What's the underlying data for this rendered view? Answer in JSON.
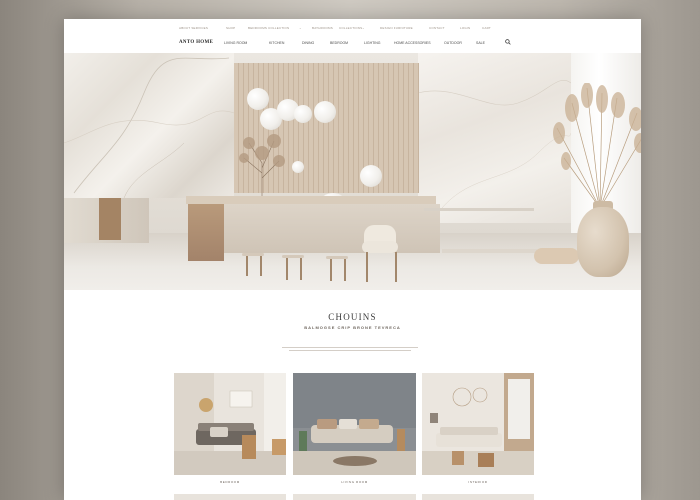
{
  "topnav": {
    "items": [
      "ABOUT SERVICES",
      "SHOP",
      "BEDROOMS COLLECTION",
      "BATHROOMS",
      "COLLECTIONS",
      "DESIGN FURNITURE",
      "CONTACT",
      "LOGIN",
      "CART"
    ]
  },
  "mainnav": {
    "logo": "ANTO HOME",
    "links": [
      "LIVING ROOM",
      "KITCHEN",
      "DINING",
      "BEDROOM",
      "LIGHTING",
      "HOME ACCESSORIES",
      "OUTDOOR",
      "SALE"
    ]
  },
  "hero": {
    "slide_count": 4,
    "active_slide": 1
  },
  "section": {
    "title": "CHOUINS",
    "subtitle": "BALMOGSE CRIP BRONE TEVRECA"
  },
  "cards": [
    {
      "caption": "BEDROOM"
    },
    {
      "caption": "LIVING ROOM"
    },
    {
      "caption": "INTERIOR"
    }
  ],
  "colors": {
    "accent": "#c9b6a0",
    "wood": "#a3836a",
    "text": "#3a3a3a"
  }
}
